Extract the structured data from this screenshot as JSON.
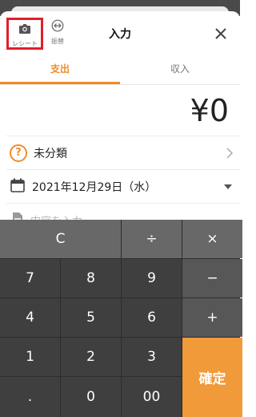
{
  "header": {
    "title": "入力",
    "receipt_label": "レシート",
    "transfer_label": "振替"
  },
  "tabs": [
    {
      "label": "支出",
      "active": true
    },
    {
      "label": "収入",
      "active": false
    }
  ],
  "amount": "¥0",
  "category": "未分類",
  "date": "2021年12月29日（水）",
  "memo_placeholder": "内容を入力",
  "keypad": {
    "clear": "C",
    "divide": "÷",
    "multiply": "×",
    "minus": "−",
    "plus": "+",
    "k7": "7",
    "k8": "8",
    "k9": "9",
    "k4": "4",
    "k5": "5",
    "k6": "6",
    "k1": "1",
    "k2": "2",
    "k3": "3",
    "dot": ".",
    "k0": "0",
    "k00": "00",
    "confirm": "確定"
  },
  "colors": {
    "accent": "#ef8a2a",
    "highlight_box": "#e0202a",
    "confirm_key": "#f09a3a"
  }
}
